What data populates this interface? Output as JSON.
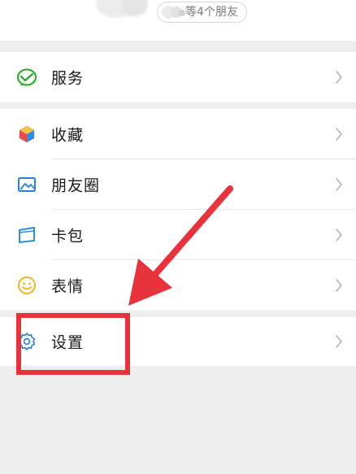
{
  "header": {
    "friends_text": "等4个朋友"
  },
  "menu": {
    "service": "服务",
    "favorites": "收藏",
    "moments": "朋友圈",
    "cards": "卡包",
    "stickers": "表情",
    "settings": "设置"
  },
  "icons": {
    "service": "wechat-pay-icon",
    "favorites": "cube-icon",
    "moments": "picture-icon",
    "cards": "wallet-icon",
    "stickers": "smiley-icon",
    "settings": "gear-icon",
    "chevron": "chevron-right-icon"
  },
  "colors": {
    "service_green": "#1aad19",
    "moments_blue": "#2782d7",
    "cards_blue": "#2a8fd6",
    "stickers_yellow": "#f5b21b",
    "settings_blue": "#2782d7",
    "annotation_red": "#e8323c",
    "page_bg": "#ededed"
  }
}
